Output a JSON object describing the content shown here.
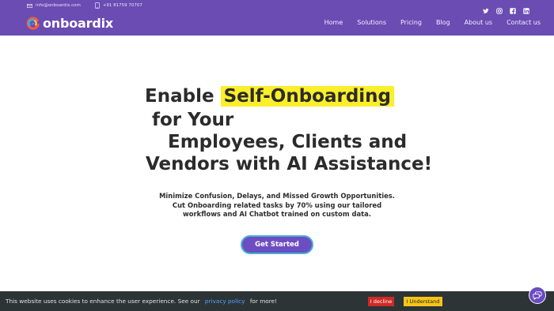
{
  "topbar": {
    "email": "info@onboardix.com",
    "phone": "+91 81759 70707",
    "icons": [
      "mail-icon",
      "phone-icon"
    ]
  },
  "socials": [
    "twitter-icon",
    "instagram-icon",
    "facebook-icon",
    "linkedin-icon"
  ],
  "brand": {
    "name": "onboardix"
  },
  "nav": {
    "items": [
      "Home",
      "Solutions",
      "Pricing",
      "Blog",
      "About us",
      "Contact us"
    ]
  },
  "hero": {
    "line1_prefix": "Enable",
    "line1_highlight": "Self-Onboarding",
    "line2": "for Your",
    "line3": "Employees, Clients and",
    "line4": "Vendors with AI Assistance!",
    "sub1": "Minimize Confusion, Delays, and Missed Growth Opportunities.",
    "sub2": "Cut Onboarding related tasks by 70% using our tailored",
    "sub3": "workflows and AI Chatbot trained on custom data.",
    "cta_label": "Get Started"
  },
  "cookie": {
    "text_before": "This website uses cookies to enhance the user experience. See our",
    "link": "privacy policy",
    "text_after": "for more!",
    "decline": "I decline",
    "accept": "I Understand"
  },
  "colors": {
    "header_bg": "#6a4cb3",
    "highlight": "#fbee2b",
    "cta_bg": "#6d4ec2",
    "cta_border": "#46b1d8",
    "cookie_bg": "#2d3436",
    "decline_bg": "#cf2a27",
    "accept_bg": "#f5c518"
  }
}
